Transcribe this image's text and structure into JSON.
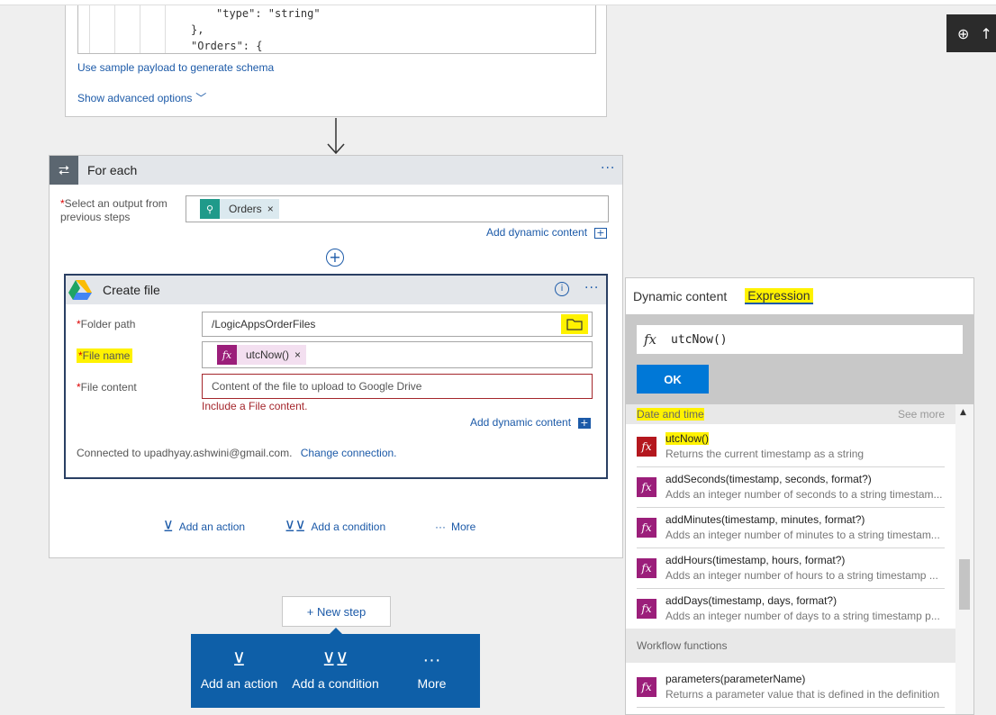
{
  "schema": {
    "code_line_1": "\"type\": \"string\"",
    "code_line_2": "},",
    "code_line_3": "\"Orders\": {",
    "sample_payload_link": "Use sample payload to generate schema",
    "advanced_options_link": "Show advanced options"
  },
  "zoom": {
    "icon": "zoom-in-icon"
  },
  "foreach": {
    "title": "For each",
    "select_label_line1": "Select an output from",
    "select_label_line2": "previous steps",
    "token": "Orders",
    "add_dynamic": "Add dynamic content"
  },
  "create_file": {
    "title": "Create file",
    "folder_label": "Folder path",
    "folder_value": "/LogicAppsOrderFiles",
    "filename_label": "File name",
    "filename_token": "utcNow()",
    "content_label": "File content",
    "content_placeholder": "Content of the file to upload to Google Drive",
    "content_error": "Include a File content.",
    "add_dynamic": "Add dynamic content",
    "connected_text": "Connected to upadhyay.ashwini@gmail.com.",
    "change_connection": "Change connection."
  },
  "inner_actions": {
    "add_action": "Add an action",
    "add_condition": "Add a condition",
    "more": "More"
  },
  "new_step": "+ New step",
  "bottom_bar": {
    "add_action": "Add an action",
    "add_condition": "Add a condition",
    "more": "More"
  },
  "panel": {
    "tab_dynamic": "Dynamic content",
    "tab_expression": "Expression",
    "expression_value": "utcNow()",
    "ok": "OK",
    "section_date": "Date and time",
    "see_more": "See more",
    "section_workflow": "Workflow functions",
    "functions": [
      {
        "name": "utcNow()",
        "desc": "Returns the current timestamp as a string"
      },
      {
        "name": "addSeconds(timestamp, seconds, format?)",
        "desc": "Adds an integer number of seconds to a string timestam..."
      },
      {
        "name": "addMinutes(timestamp, minutes, format?)",
        "desc": "Adds an integer number of minutes to a string timestam..."
      },
      {
        "name": "addHours(timestamp, hours, format?)",
        "desc": "Adds an integer number of hours to a string timestamp ..."
      },
      {
        "name": "addDays(timestamp, days, format?)",
        "desc": "Adds an integer number of days to a string timestamp p..."
      }
    ],
    "workflow_functions": [
      {
        "name": "parameters(parameterName)",
        "desc": "Returns a parameter value that is defined in the definition"
      }
    ]
  },
  "colors": {
    "accent": "#1c5aa8",
    "highlight": "#fff200",
    "function_icon": "#9b1e7a",
    "bottom_bar": "#0e5fa8",
    "ok_button": "#0078d7"
  }
}
